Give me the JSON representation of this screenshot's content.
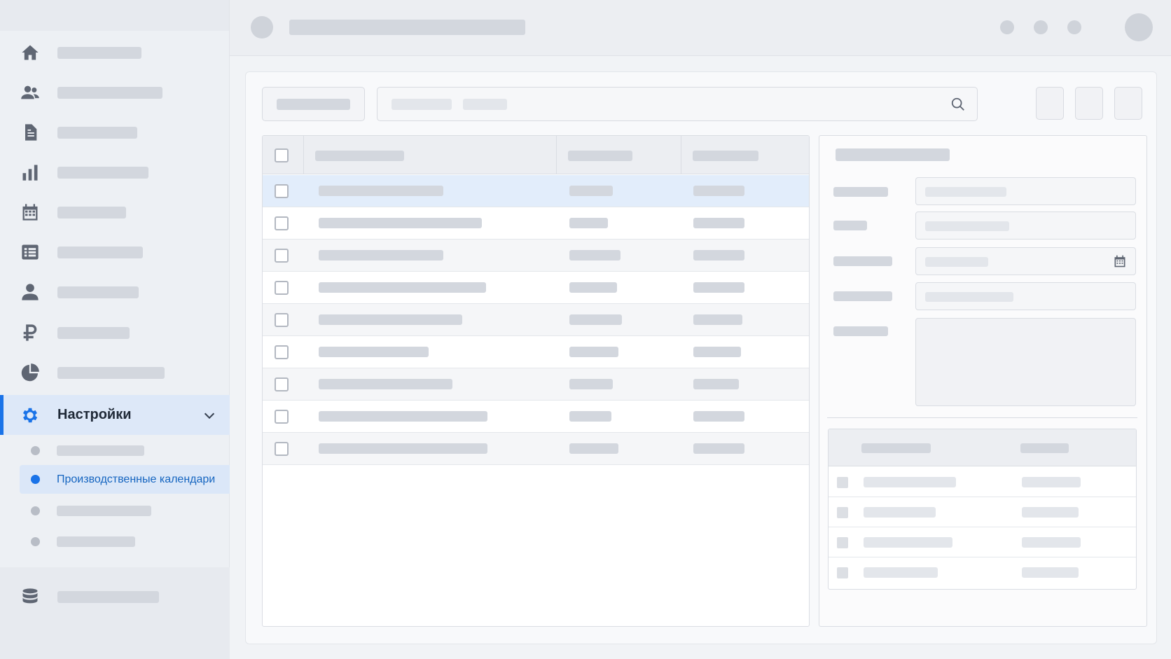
{
  "sidebar": {
    "items": [
      {
        "icon": "home-icon"
      },
      {
        "icon": "users-icon"
      },
      {
        "icon": "document-icon"
      },
      {
        "icon": "bar-chart-icon"
      },
      {
        "icon": "calendar-icon"
      },
      {
        "icon": "list-icon"
      },
      {
        "icon": "user-icon"
      },
      {
        "icon": "ruble-icon"
      },
      {
        "icon": "pie-chart-icon"
      },
      {
        "icon": "gear-icon",
        "label": "Настройки",
        "expanded": true
      }
    ],
    "settings_submenu": [
      {
        "label": ""
      },
      {
        "label": "Производственные календари",
        "active": true
      },
      {
        "label": ""
      },
      {
        "label": ""
      }
    ],
    "footer_icon": "database-icon"
  },
  "colors": {
    "accent": "#1a73e8",
    "active_bg": "#dde8f8",
    "selected_row": "#e2edfb",
    "placeholder": "#d3d7de"
  },
  "table": {
    "row_count": 9,
    "selected_row": 1
  },
  "detail_panel": {
    "date_field_icon": "calendar-icon"
  },
  "toolbar": {
    "search_icon": "search-icon"
  }
}
